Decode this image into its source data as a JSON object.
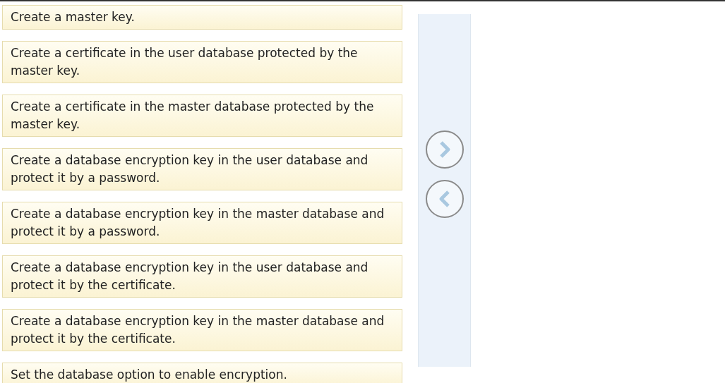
{
  "items": [
    {
      "text": "Create a master key."
    },
    {
      "text": "Create a certificate in the user database protected by the master key."
    },
    {
      "text": "Create a certificate in the master database protected by the master key."
    },
    {
      "text": "Create a database encryption key in the user database and protect it by a password."
    },
    {
      "text": "Create a database encryption key in the master database and protect it by a password."
    },
    {
      "text": "Create a database encryption key in the user database and protect it by the certificate."
    },
    {
      "text": "Create a database encryption key in the master database and protect it by the certificate."
    },
    {
      "text": "Set the database option to enable encryption."
    }
  ],
  "move_buttons": [
    {
      "kind": "right"
    },
    {
      "kind": "left"
    }
  ]
}
